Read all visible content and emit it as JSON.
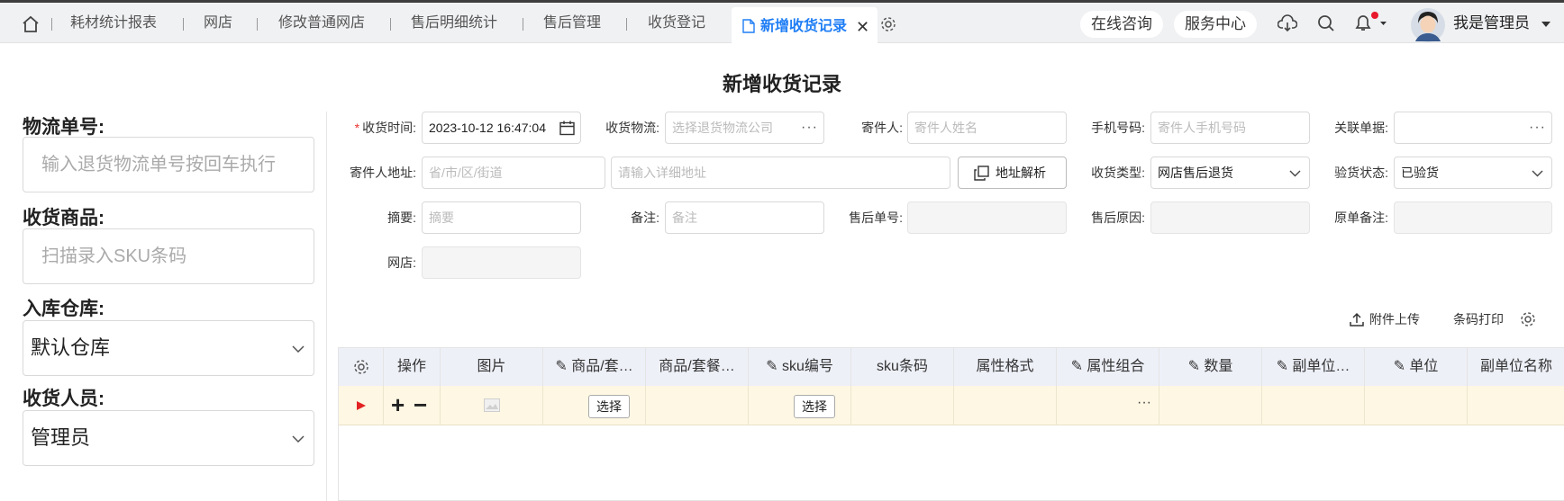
{
  "tabs": {
    "home_icon": "home-icon",
    "items": [
      "耗材统计报表",
      "网店",
      "修改普通网店",
      "售后明细统计",
      "售后管理",
      "收货登记"
    ],
    "active": "新增收货记录",
    "online": "在线咨询",
    "service": "服务中心",
    "user": "我是管理员"
  },
  "page": {
    "title": "新增收货记录"
  },
  "left": {
    "logistics_label": "物流单号:",
    "logistics_placeholder": "输入退货物流单号按回车执行",
    "goods_label": "收货商品:",
    "goods_placeholder": "扫描录入SKU条码",
    "warehouse_label": "入库仓库:",
    "warehouse_value": "默认仓库",
    "staff_label": "收货人员:",
    "staff_value": "管理员"
  },
  "form": {
    "time_label": "收货时间:",
    "time_value": "2023-10-12 16:47:04",
    "logistics_label": "收货物流:",
    "logistics_placeholder": "选择退货物流公司",
    "sender_label": "寄件人:",
    "sender_placeholder": "寄件人姓名",
    "phone_label": "手机号码:",
    "phone_placeholder": "寄件人手机号码",
    "related_label": "关联单据:",
    "address_label": "寄件人地址:",
    "region_placeholder": "省/市/区/街道",
    "detail_placeholder": "请输入详细地址",
    "parse_button": "地址解析",
    "type_label": "收货类型:",
    "type_value": "网店售后退货",
    "inspect_label": "验货状态:",
    "inspect_value": "已验货",
    "summary_label": "摘要:",
    "summary_placeholder": "摘要",
    "remark_label": "备注:",
    "remark_placeholder": "备注",
    "aftersale_no_label": "售后单号:",
    "aftersale_reason_label": "售后原因:",
    "orig_remark_label": "原单备注:",
    "shop_label": "网店:"
  },
  "toolbar": {
    "upload": "附件上传",
    "print": "条码打印"
  },
  "grid": {
    "columns": [
      "操作",
      "图片",
      "商品/套…",
      "商品/套餐…",
      "sku编号",
      "sku条码",
      "属性格式",
      "属性组合",
      "数量",
      "副单位…",
      "单位",
      "副单位名称"
    ],
    "row": {
      "select1": "选择",
      "select2": "选择"
    }
  },
  "colors": {
    "accent": "#1f7ef5",
    "row_bg": "#fdf7e3",
    "header_bg": "#eef0f8"
  }
}
